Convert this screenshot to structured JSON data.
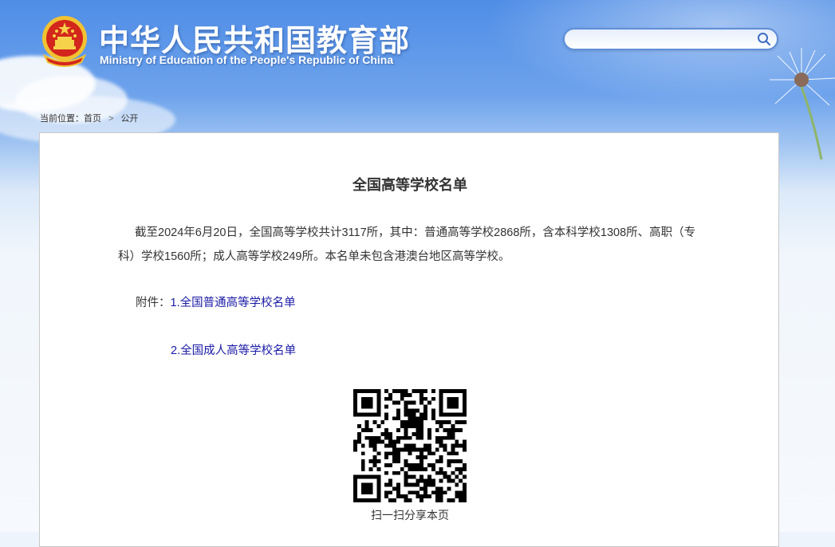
{
  "header": {
    "title": "中华人民共和国教育部",
    "subtitle": "Ministry of Education of the People's Republic of China",
    "emblem_icon": "national-emblem-icon"
  },
  "search": {
    "value": "",
    "placeholder": "",
    "button_icon": "search-icon"
  },
  "breadcrumb": {
    "prefix": "当前位置：",
    "items": [
      "首页",
      "公开"
    ],
    "separator": ">"
  },
  "article": {
    "title": "全国高等学校名单",
    "paragraph": "截至2024年6月20日，全国高等学校共计3117所，其中：普通高等学校2868所，含本科学校1308所、高职（专科）学校1560所；成人高等学校249所。本名单未包含港澳台地区高等学校。",
    "attachments_label": "附件：",
    "attachments": [
      {
        "label": "1.全国普通高等学校名单"
      },
      {
        "label": "2.全国成人高等学校名单"
      }
    ],
    "qr_caption": "扫一扫分享本页"
  },
  "colors": {
    "link": "#1a1aa6",
    "text": "#333333",
    "header_blue": "#4f8de6"
  }
}
